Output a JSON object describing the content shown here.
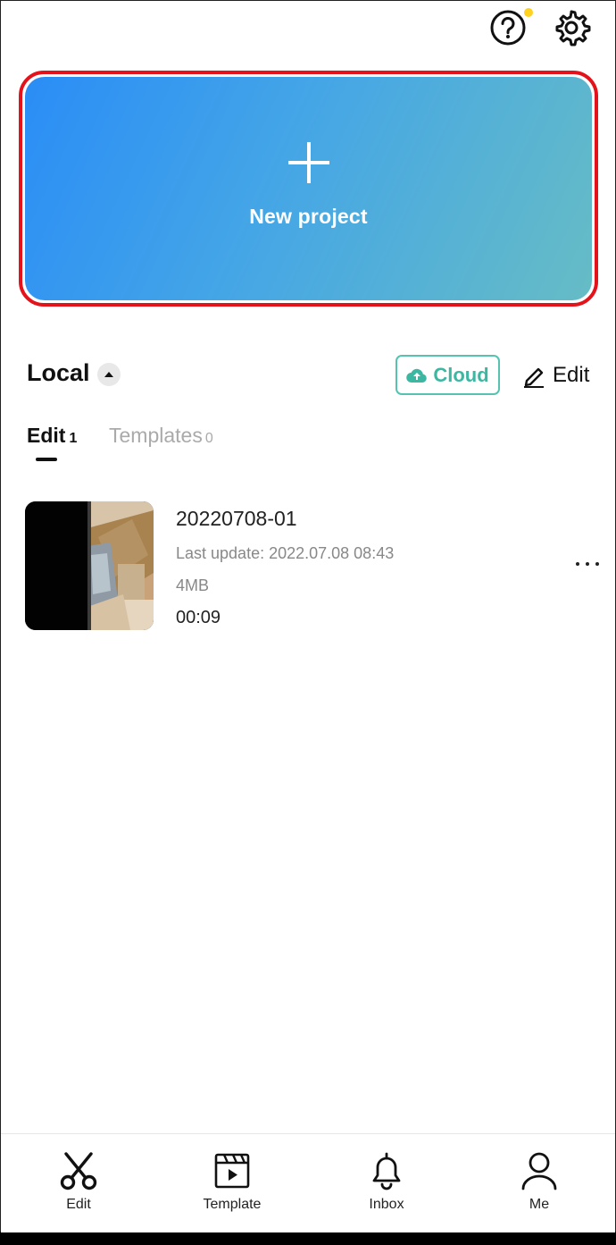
{
  "header": {
    "help_icon": "help-circle-icon",
    "settings_icon": "gear-icon",
    "notify_color": "#ffd21f"
  },
  "new_project": {
    "label": "New project",
    "icon": "plus-icon",
    "gradient_start": "#2a8df6",
    "gradient_end": "#66bcc5",
    "highlight_border": "#e4121a"
  },
  "local": {
    "title": "Local",
    "cloud_label": "Cloud",
    "edit_label": "Edit"
  },
  "tabs": [
    {
      "label": "Edit",
      "count": "1",
      "active": true
    },
    {
      "label": "Templates",
      "count": "0",
      "active": false
    }
  ],
  "projects": [
    {
      "name": "20220708-01",
      "updated": "Last update: 2022.07.08 08:43",
      "size": "4MB",
      "duration": "00:09"
    }
  ],
  "nav": [
    {
      "label": "Edit",
      "icon": "scissors-icon"
    },
    {
      "label": "Template",
      "icon": "template-icon"
    },
    {
      "label": "Inbox",
      "icon": "bell-icon"
    },
    {
      "label": "Me",
      "icon": "user-icon"
    }
  ]
}
